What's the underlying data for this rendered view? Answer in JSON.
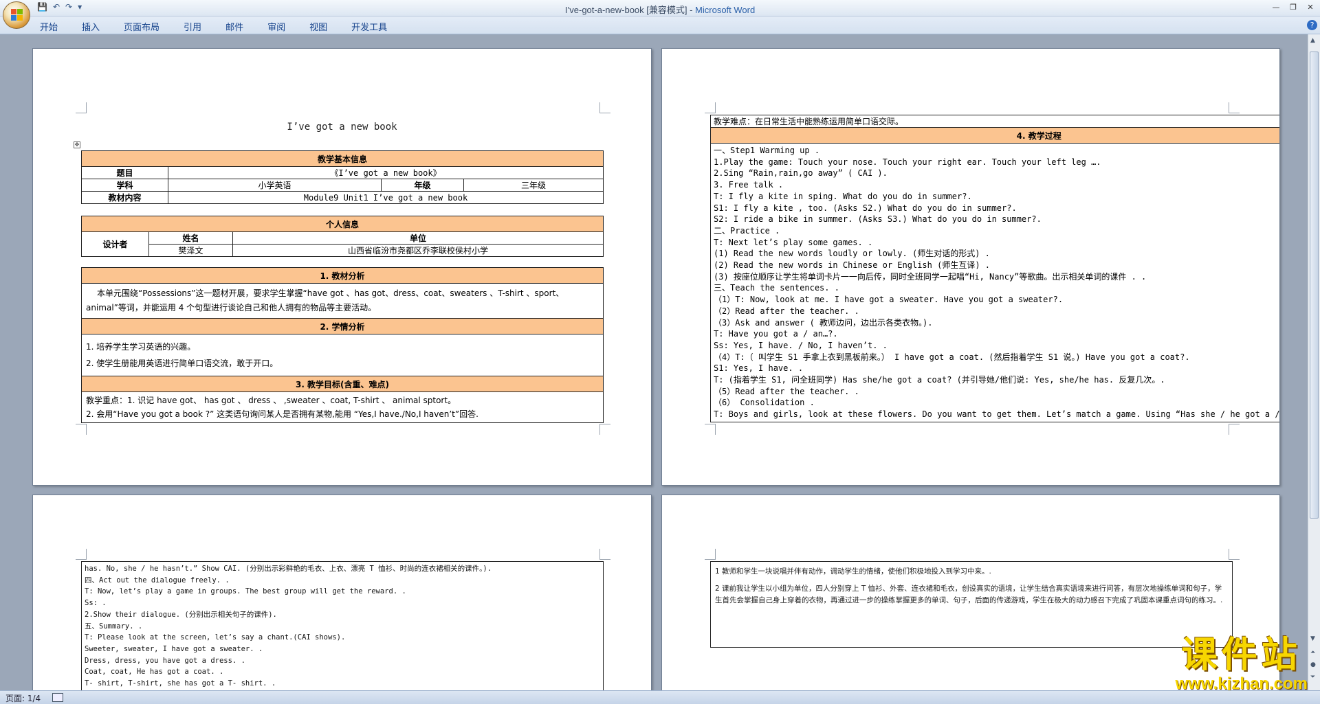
{
  "window": {
    "title_prefix": "I’ve-got-a-new-book [兼容模式] - ",
    "app_name": "Microsoft Word"
  },
  "ribbon": {
    "tabs": [
      "开始",
      "插入",
      "页面布局",
      "引用",
      "邮件",
      "审阅",
      "视图",
      "开发工具"
    ]
  },
  "page1": {
    "title": "I’ve got a new book",
    "basic_info": {
      "header": "教学基本信息",
      "topic_label": "题目",
      "topic_value": "《I’ve got a new book》",
      "subject_label": "学科",
      "subject_value": "小学英语",
      "grade_label": "年级",
      "grade_value": "三年级",
      "content_label": "教材内容",
      "content_value": "Module9 Unit1 I’ve got a new book"
    },
    "personal_info": {
      "header": "个人信息",
      "designer_label": "设计者",
      "name_label": "姓名",
      "unit_label": "单位",
      "name_value": "樊泽文",
      "unit_value": "山西省临汾市尧都区乔李联校侯村小学"
    },
    "analysis": {
      "header": "1.  教材分析",
      "text": "本单元围绕“Possessions”这一题材开展，要求学生掌握“have got 、has got、dress、coat、sweaters 、T-shirt 、sport、animal”等词，并能运用 4 个句型进行谈论自己和他人拥有的物品等主要活动。"
    },
    "learner": {
      "header": "2.  学情分析",
      "line1": "1. 培养学生学习英语的兴趣。",
      "line2": "2. 使学生册能用英语进行简单口语交流，敢于开口。"
    },
    "goals": {
      "header": "3.  教学目标(含重、难点)",
      "line1": "教学重点：1. 识记 have got、 has got  、  dress  、 ,sweater 、coat, T-shirt 、 animal sptort。",
      "line2": "2. 会用“Have you got a  book ?” 这类语句询问某人是否拥有某物,能用 “Yes,I have./No,I haven’t”回答."
    }
  },
  "page2": {
    "difficulty": "教学难点：在日常生活中能熟练运用简单口语交际。",
    "process_header": "4.  教学过程",
    "lines": [
      "一、Step1 Warming up .",
      "1.Play the game: Touch your nose. Touch your right ear. Touch your left leg ….",
      "2.Sing “Rain,rain,go away” ( CAI ).",
      "3. Free talk .",
      "T: I fly a kite in sping. What do you do in summer?.",
      "S1: I fly a kite , too. (Asks S2.) What do you do in summer?.",
      "S2: I ride a bike in summer. (Asks S3.) What do you do in summer?.",
      "二、Practice .",
      " T: Next let’s play some games. .",
      "(1) Read the new words loudly or lowly. (师生对话的形式) .",
      "(2) Read the new words in Chinese or English (师生互译) .",
      "(3) 按座位顺序让学生将单词卡片一一向后传，同时全班同学一起唱“Hi, Nancy”等歌曲。出示相关单词的课件 . .",
      "三、Teach the sentences. .",
      "（1）T: Now, look at me. I have got a sweater. Have you got a sweater?.",
      "（2）Read after the teacher. .",
      "（3）Ask and answer ( 教师边问，边出示各类衣物。).",
      "T: Have you got a / an…?.",
      "Ss: Yes, I have. / No, I haven’t. .",
      "（4）T:（ 叫学生 S1 手拿上衣到黑板前来。） I have got a coat. (然后指着学生 S1 说。) Have you got a coat?.",
      "S1: Yes, I have. .",
      "T: (指着学生 S1, 问全班同学) Has she/he got a coat? (并引导她/他们说: Yes, she/he has. 反复几次。.",
      "（5）Read after the teacher. .",
      "（6） Consolidation .",
      "T: Boys and girls, look at these flowers. Do you want to get them. Let’s match a game. Using “Has she / he got a /an…? Yes, she /he"
    ]
  },
  "page3": {
    "lines": [
      "has. No, she / he hasn’t.” Show CAI. (分别出示彩鲜艳的毛衣、上衣、漂亮 T 恤衫、时尚的连衣裙相关的课件。).",
      "四、Act out the dialogue freely. .",
      "T: Now, let’s play a game in groups. The best group will get the reward. .",
      "Ss: .",
      "2.Show their dialogue. (分别出示相关句子的课件).",
      "五、Summary. .",
      "T: Please look at the screen, let’s say a chant.(CAI shows).",
      "  Sweeter, sweater, I have got a sweater. .",
      "  Dress, dress, you have got a dress. .",
      "  Coat, coat, He has got a coat. .",
      "   T- shirt, T-shirt, she has got a T- shirt. ."
    ]
  },
  "page4": {
    "para1": "1 教师和学生一块说唱并伴有动作，调动学生的情绪，使他们积极地投入到学习中来。.",
    "para2": "2 课前我让学生以小组为单位，四人分别穿上 T 恤衫、外套、连衣裙和毛衣，创设真实的语境，让学生结合真实语境来进行问答，有层次地操练单词和句子，学生首先会掌握自己身上穿着的衣物，再通过进一步的操练掌握更多的单词、句子，后面的传递游戏，学生在极大的动力感召下完成了巩固本课重点词句的练习。."
  },
  "status": {
    "page": "页面: 1/4"
  },
  "watermark": {
    "big": "课件站",
    "url": "www.kjzhan.com"
  },
  "colors": {
    "header_fill": "#fbc490",
    "workspace": "#9ba7b8",
    "title_app": "#2a5fa8"
  }
}
